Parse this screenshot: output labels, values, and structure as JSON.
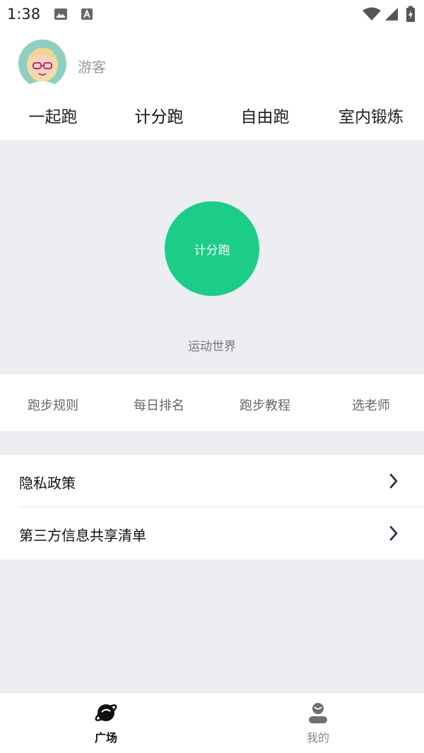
{
  "status_bar": {
    "time": "1:38",
    "icons": [
      "image-icon",
      "text-a-icon",
      "wifi-icon",
      "signal-icon",
      "battery-charging-icon"
    ]
  },
  "profile": {
    "username": "游客",
    "avatar": "cartoon-girl-avatar"
  },
  "tabs": [
    {
      "label": "一起跑"
    },
    {
      "label": "计分跑"
    },
    {
      "label": "自由跑"
    },
    {
      "label": "室内锻炼"
    }
  ],
  "hero": {
    "button_label": "计分跑",
    "caption": "运动世界",
    "accent_color": "#1ccd88"
  },
  "quick_links": [
    {
      "label": "跑步规则"
    },
    {
      "label": "每日排名"
    },
    {
      "label": "跑步教程"
    },
    {
      "label": "选老师"
    }
  ],
  "list": [
    {
      "label": "隐私政策",
      "icon": "chevron-right-icon"
    },
    {
      "label": "第三方信息共享清单",
      "icon": "chevron-right-icon"
    }
  ],
  "bottom_nav": [
    {
      "label": "广场",
      "icon": "planet-icon",
      "active": true
    },
    {
      "label": "我的",
      "icon": "user-icon",
      "active": false
    }
  ]
}
